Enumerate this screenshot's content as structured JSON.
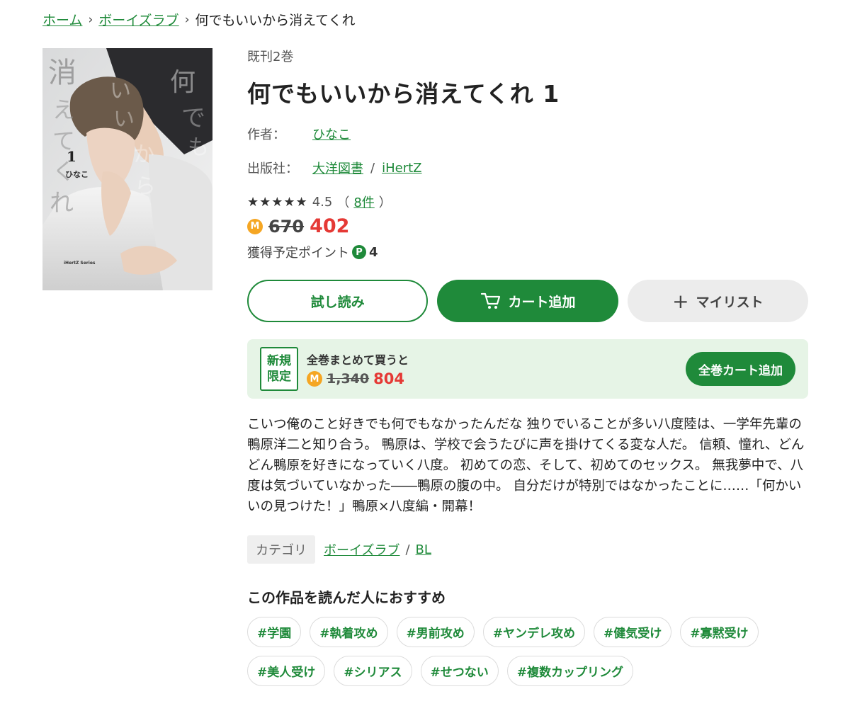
{
  "breadcrumb": {
    "home": "ホーム",
    "category": "ボーイズラブ",
    "current": "何でもいいから消えてくれ"
  },
  "cover": {
    "title_letters": [
      "消",
      "え",
      "て",
      "く",
      "れ"
    ],
    "title_letters_right": [
      "何",
      "で",
      "も",
      "い",
      "い",
      "か",
      "ら"
    ],
    "volume": "1",
    "author": "ひなこ",
    "series": "iHertZ Series"
  },
  "product": {
    "series_count": "既刊2巻",
    "title": "何でもいいから消えてくれ 1",
    "author_label": "作者：",
    "author": "ひなこ",
    "publisher_label": "出版社：",
    "publisher": "大洋図書",
    "publisher_sep": "/",
    "label": "iHertZ",
    "stars": "★★★★★",
    "rating": "4.5",
    "review_open": "（",
    "review_count": "8件",
    "review_close": "）",
    "coin_symbol": "M",
    "old_price": "670",
    "new_price": "402",
    "points_label": "獲得予定ポイント",
    "points_symbol": "P",
    "points_value": "4"
  },
  "buttons": {
    "trial": "試し読み",
    "cart": "カート追加",
    "mylist_plus": "+",
    "mylist": "マイリスト"
  },
  "bundle": {
    "badge_line1": "新規",
    "badge_line2": "限定",
    "label": "全巻まとめて買うと",
    "old_price": "1,340",
    "new_price": "804",
    "button": "全巻カート追加"
  },
  "description": "こいつ俺のこと好きでも何でもなかったんだな 独りでいることが多い八度陸は、一学年先輩の鴨原洋二と知り合う。 鴨原は、学校で会うたびに声を掛けてくる変な人だ。 信頼、憧れ、どんどん鴨原を好きになっていく八度。 初めての恋、そして、初めてのセックス。 無我夢中で、八度は気づいていなかった――鴨原の腹の中。 自分だけが特別ではなかったことに……「何かいいの見つけた！」鴨原×八度編・開幕！",
  "category": {
    "label": "カテゴリ",
    "link1": "ボーイズラブ",
    "sep": "/",
    "link2": "BL"
  },
  "recommend": {
    "title": "この作品を読んだ人におすすめ",
    "tags": [
      "#学園",
      "#執着攻め",
      "#男前攻め",
      "#ヤンデレ攻め",
      "#健気受け",
      "#寡黙受け",
      "#美人受け",
      "#シリアス",
      "#せつない",
      "#複数カップリング"
    ]
  },
  "colors": {
    "accent": "#1f8a3a",
    "price_red": "#e53935",
    "coin": "#f5a623",
    "bundle_bg": "#e6f4e6"
  }
}
